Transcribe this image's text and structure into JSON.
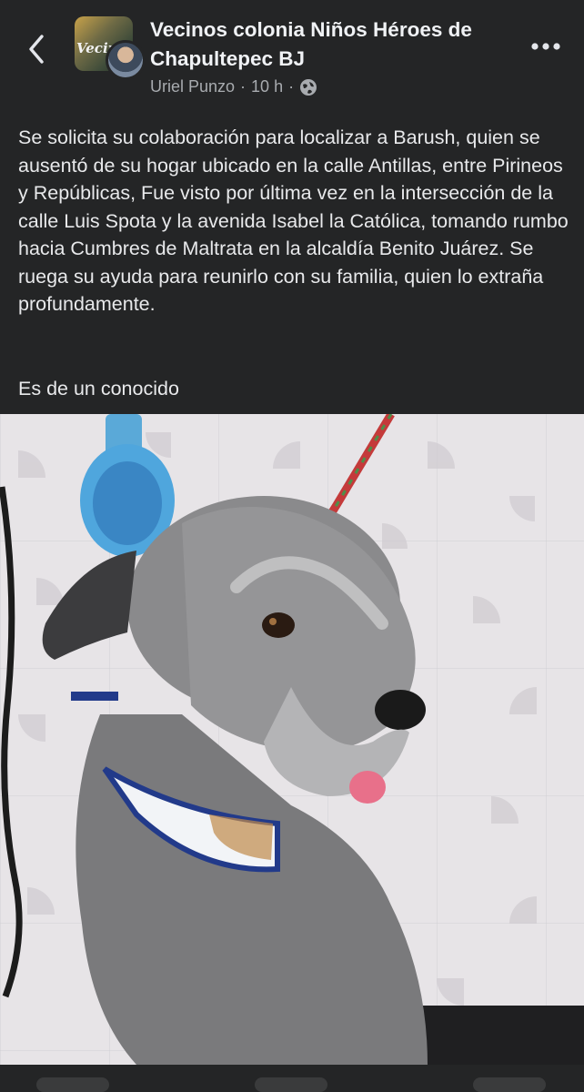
{
  "header": {
    "group_name": "Vecinos colonia Niños Héroes de Chapultepec BJ",
    "group_avatar_text": "Vecinos",
    "author": "Uriel Punzo",
    "time": "10 h",
    "separator": "·",
    "privacy_icon": "globe-icon",
    "back_icon": "chevron-left-icon",
    "more_icon": "more-horizontal-icon"
  },
  "post": {
    "body": "Se solicita su colaboración para localizar a Barush, quien se ausentó de su hogar ubicado en la calle Antillas, entre Pirineos y Repúblicas,  Fue visto por última vez en la intersección de la calle Luis Spota y la avenida Isabel la Católica, tomando rumbo hacia Cumbres de Maltrata en la alcaldía Benito Juárez. Se ruega su ayuda para reunirlo con su familia, quien lo extraña profundamente.",
    "footer_line": "Es de un conocido"
  },
  "colors": {
    "background": "#242526",
    "text": "#e4e6eb",
    "meta": "#a8abaf"
  }
}
